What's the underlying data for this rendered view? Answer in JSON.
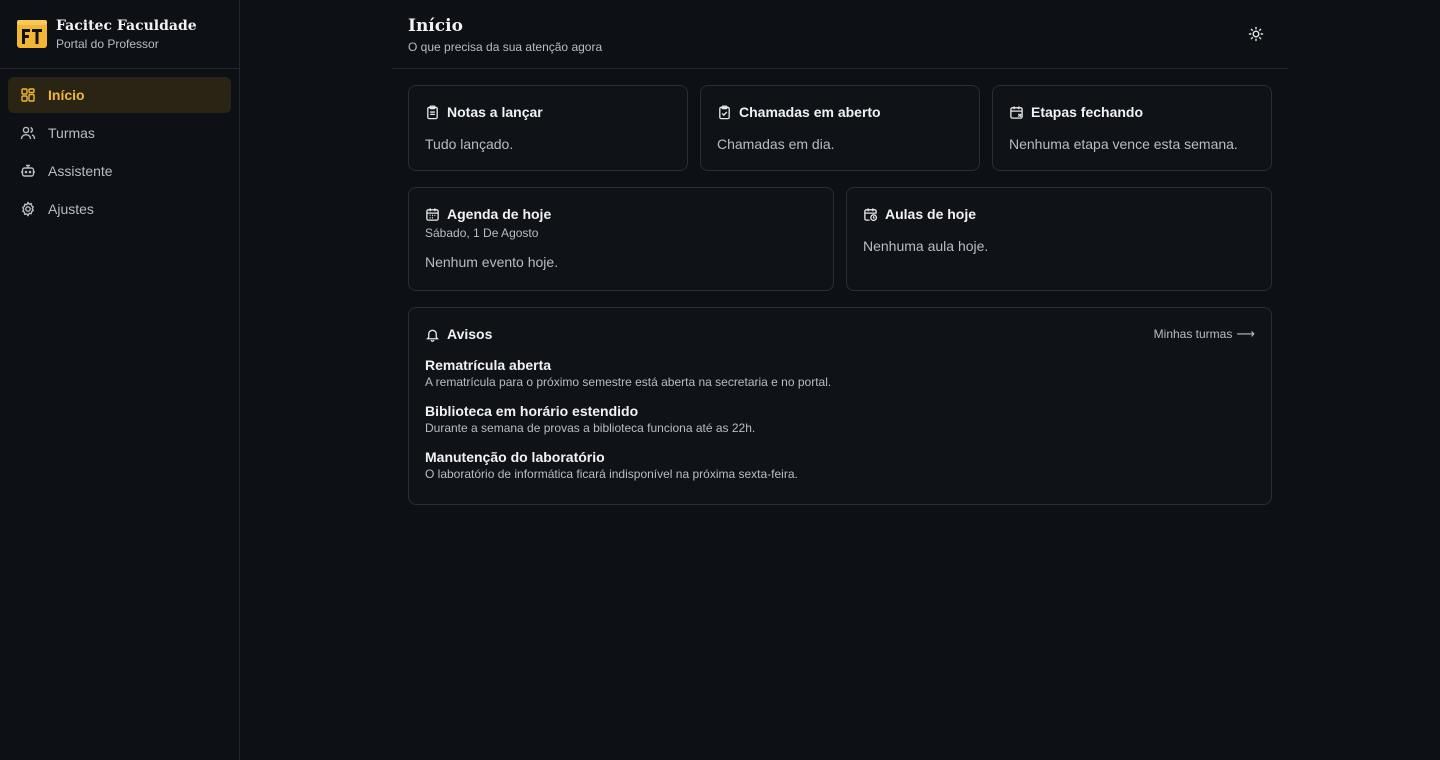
{
  "brand": {
    "name": "Facitec Faculdade",
    "subtitle": "Portal do Professor",
    "accent": "#f2b632"
  },
  "sidebar": {
    "items": [
      {
        "label": "Início",
        "icon": "grid-icon",
        "active": true
      },
      {
        "label": "Turmas",
        "icon": "users-icon",
        "active": false
      },
      {
        "label": "Assistente",
        "icon": "bot-icon",
        "active": false
      },
      {
        "label": "Ajustes",
        "icon": "gear-icon",
        "active": false
      }
    ]
  },
  "header": {
    "title": "Início",
    "subtitle": "O que precisa da sua atenção agora",
    "theme_icon": "sun-icon"
  },
  "cards_top": [
    {
      "title": "Notas a lançar",
      "icon": "clipboard-icon",
      "body": "Tudo lançado."
    },
    {
      "title": "Chamadas em aberto",
      "icon": "clipboard-check-icon",
      "body": "Chamadas em dia."
    },
    {
      "title": "Etapas fechando",
      "icon": "calendar-x-icon",
      "body": "Nenhuma etapa vence esta semana."
    }
  ],
  "cards_mid": [
    {
      "title": "Agenda de hoje",
      "icon": "calendar-icon",
      "date": "Sábado, 1 De Agosto",
      "body": "Nenhum evento hoje."
    },
    {
      "title": "Aulas de hoje",
      "icon": "calendar-clock-icon",
      "body": "Nenhuma aula hoje."
    }
  ],
  "avisos": {
    "title": "Avisos",
    "icon": "bell-icon",
    "link": "Minhas turmas",
    "link_arrow": "⟶",
    "items": [
      {
        "title": "Rematrícula aberta",
        "text": "A rematrícula para o próximo semestre está aberta na secretaria e no portal."
      },
      {
        "title": "Biblioteca em horário estendido",
        "text": "Durante a semana de provas a biblioteca funciona até as 22h."
      },
      {
        "title": "Manutenção do laboratório",
        "text": "O laboratório de informática ficará indisponível na próxima sexta-feira."
      }
    ]
  }
}
